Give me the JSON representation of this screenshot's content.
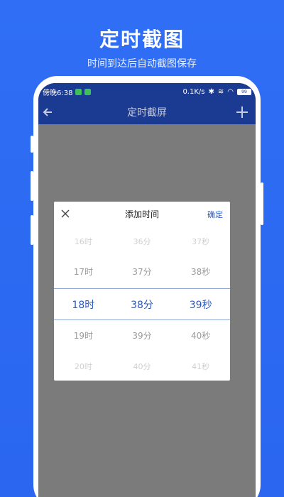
{
  "hero": {
    "title": "定时截图",
    "subtitle": "时间到达后自动截图保存"
  },
  "status_bar": {
    "time": "傍晚6:38",
    "network": "0.1K/s",
    "battery": "99"
  },
  "nav": {
    "title": "定时截屏"
  },
  "dialog": {
    "title": "添加时间",
    "confirm_label": "确定",
    "rows": [
      {
        "hour": "16时",
        "minute": "36分",
        "second": "37秒"
      },
      {
        "hour": "17时",
        "minute": "37分",
        "second": "38秒"
      },
      {
        "hour": "18时",
        "minute": "38分",
        "second": "39秒"
      },
      {
        "hour": "19时",
        "minute": "39分",
        "second": "40秒"
      },
      {
        "hour": "20时",
        "minute": "40分",
        "second": "41秒"
      }
    ]
  },
  "colors": {
    "background": "#2f6ef5",
    "navbar": "#1b3b93",
    "accent": "#2b59c3",
    "overlay": "#7b7b7b"
  }
}
